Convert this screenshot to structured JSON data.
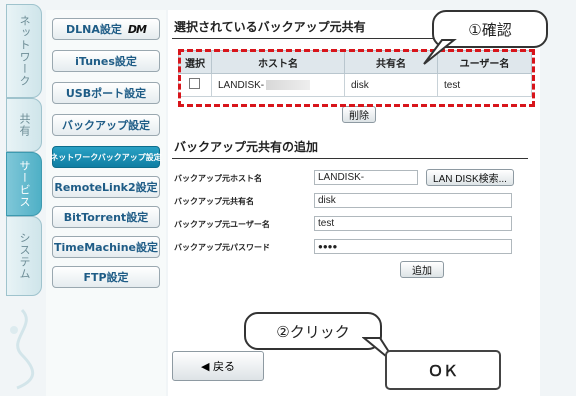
{
  "tabs": [
    {
      "label": "ネットワーク"
    },
    {
      "label": "共有"
    },
    {
      "label": "サービス"
    },
    {
      "label": "システム"
    }
  ],
  "menu": {
    "dlna": "DLNA設定",
    "dlna_logo": "DM",
    "itunes": "iTunes設定",
    "usb_port": "USBポート設定",
    "backup": "バックアップ設定",
    "network_backup": "ネットワークバックアップ設定",
    "remote_link": "RemoteLink2設定",
    "bittorrent": "BitTorrent設定",
    "time_machine": "TimeMachine設定",
    "ftp": "FTP設定"
  },
  "selected_section": {
    "title": "選択されているバックアップ元共有",
    "headers": [
      "選択",
      "ホスト名",
      "共有名",
      "ユーザー名"
    ],
    "rows": [
      {
        "host": "LANDISK-",
        "share": "disk",
        "user": "test"
      }
    ],
    "delete_button": "削除"
  },
  "add_section": {
    "title": "バックアップ元共有の追加",
    "host_label": "バックアップ元ホスト名",
    "host_value": "LANDISK-",
    "search_button": "LAN DISK検索...",
    "share_label": "バックアップ元共有名",
    "share_value": "disk",
    "user_label": "バックアップ元ユーザー名",
    "user_value": "test",
    "password_label": "バックアップ元パスワード",
    "password_value": "●●●●",
    "add_button": "追加"
  },
  "annotations": {
    "confirm": "①確認",
    "click": "②クリック"
  },
  "footer": {
    "back": "◀ 戻る",
    "ok": "ＯＫ"
  },
  "colors": {
    "accent": "#1a8fb3",
    "highlight_dash": "#d8151b"
  }
}
